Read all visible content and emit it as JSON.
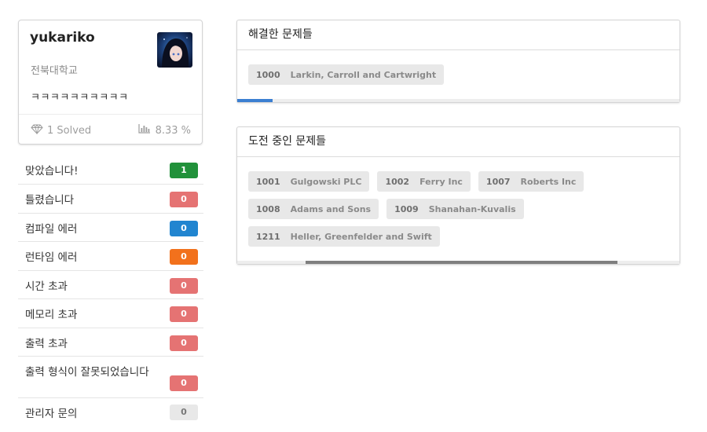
{
  "profile": {
    "username": "yukariko",
    "school": "전북대학교",
    "bio": "ㅋㅋㅋㅋㅋㅋㅋㅋㅋㅋ",
    "solved_text": "1 Solved",
    "rate_text": "8.33 %",
    "icons": {
      "solved": "diamond-icon",
      "rate": "bar-chart-icon"
    }
  },
  "results": [
    {
      "label": "맞았습니다!",
      "count": "1",
      "color": "#21913a"
    },
    {
      "label": "틀렸습니다",
      "count": "0",
      "color": "#e57373"
    },
    {
      "label": "컴파일 에러",
      "count": "0",
      "color": "#2185d0"
    },
    {
      "label": "런타임 에러",
      "count": "0",
      "color": "#f2711c"
    },
    {
      "label": "시간 초과",
      "count": "0",
      "color": "#e57373"
    },
    {
      "label": "메모리 초과",
      "count": "0",
      "color": "#e57373"
    },
    {
      "label": "출력 초과",
      "count": "0",
      "color": "#e57373"
    },
    {
      "label": "출력 형식이 잘못되었습니다",
      "count": "0",
      "color": "#e57373"
    },
    {
      "label": "관리자 문의",
      "count": "0",
      "color": "#e8e8e8",
      "text_color": "#777777"
    }
  ],
  "solved_panel": {
    "title": "해결한 문제들",
    "problems": [
      {
        "id": "1000",
        "title": "Larkin, Carroll and Cartwright"
      }
    ],
    "progress": {
      "start": 0,
      "end": 0.08,
      "color": "#3b7fd1"
    }
  },
  "trying_panel": {
    "title": "도전 중인 문제들",
    "problems": [
      {
        "id": "1001",
        "title": "Gulgowski PLC"
      },
      {
        "id": "1002",
        "title": "Ferry Inc"
      },
      {
        "id": "1007",
        "title": "Roberts Inc"
      },
      {
        "id": "1008",
        "title": "Adams and Sons"
      },
      {
        "id": "1009",
        "title": "Shanahan-Kuvalis"
      },
      {
        "id": "1211",
        "title": "Heller, Greenfelder and Swift"
      }
    ],
    "progress": {
      "start": 0.155,
      "end": 0.86,
      "color": "#7f7f7f"
    }
  }
}
